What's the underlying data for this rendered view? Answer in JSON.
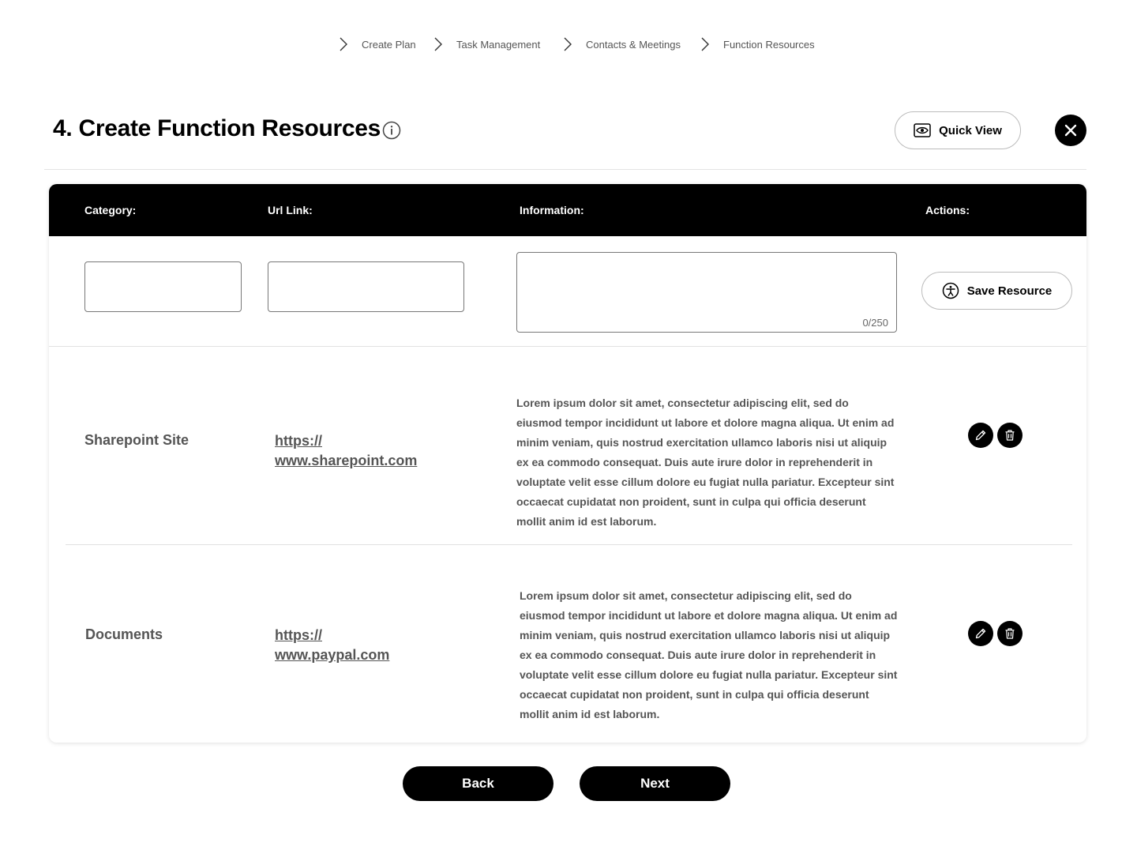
{
  "breadcrumb": {
    "items": [
      {
        "label": "Create Plan"
      },
      {
        "label": "Task Management"
      },
      {
        "label": "Contacts & Meetings"
      },
      {
        "label": "Function Resources"
      }
    ]
  },
  "header": {
    "title": "4. Create Function Resources",
    "quick_view_label": "Quick View"
  },
  "table": {
    "columns": [
      "Category:",
      "Url Link:",
      "Information:",
      "Actions:"
    ],
    "new_entry": {
      "category_value": "",
      "url_value": "",
      "information_value": "",
      "counter": "0/250",
      "save_label": "Save Resource"
    },
    "rows": [
      {
        "category": "Sharepoint Site",
        "url": "https://\nwww.sharepoint.com",
        "information": "Lorem ipsum dolor sit amet, consectetur adipiscing elit, sed do eiusmod tempor incididunt ut labore et dolore magna aliqua. Ut enim ad minim veniam, quis nostrud exercitation ullamco laboris nisi ut aliquip ex ea commodo consequat. Duis aute irure dolor in reprehenderit in voluptate velit esse cillum dolore eu fugiat nulla pariatur. Excepteur sint occaecat cupidatat non proident, sunt in culpa qui officia deserunt mollit anim id est laborum."
      },
      {
        "category": "Documents",
        "url": "https://\nwww.paypal.com",
        "information": "Lorem ipsum dolor sit amet, consectetur adipiscing elit, sed do eiusmod tempor incididunt ut labore et dolore magna aliqua. Ut enim ad minim veniam, quis nostrud exercitation ullamco laboris nisi ut aliquip ex ea commodo consequat. Duis aute irure dolor in reprehenderit in voluptate velit esse cillum dolore eu fugiat nulla pariatur. Excepteur sint occaecat cupidatat non proident, sunt in culpa qui officia deserunt mollit anim id est laborum."
      }
    ]
  },
  "footer": {
    "back_label": "Back",
    "next_label": "Next"
  }
}
